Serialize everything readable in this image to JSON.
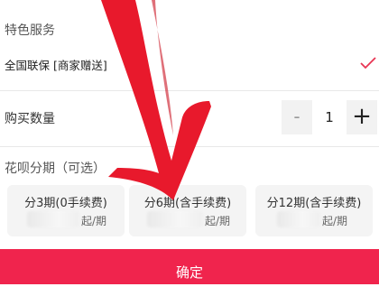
{
  "special_service": {
    "title": "特色服务",
    "item_label": "全国联保 [商家赠送]",
    "check_icon": "check-icon"
  },
  "quantity": {
    "label": "购买数量",
    "minus": "-",
    "value": "1",
    "plus": "+"
  },
  "installment": {
    "title": "花呗分期（可选）",
    "options": [
      {
        "title": "分3期(0手续费)",
        "suffix": "起/期"
      },
      {
        "title": "分6期(含手续费)",
        "suffix": "起/期"
      },
      {
        "title": "分12期(含手续费)",
        "suffix": "起/期"
      }
    ]
  },
  "confirm_button": {
    "label": "确定"
  },
  "colors": {
    "accent": "#f0244d",
    "overlay_arrow": "#e8192c"
  }
}
